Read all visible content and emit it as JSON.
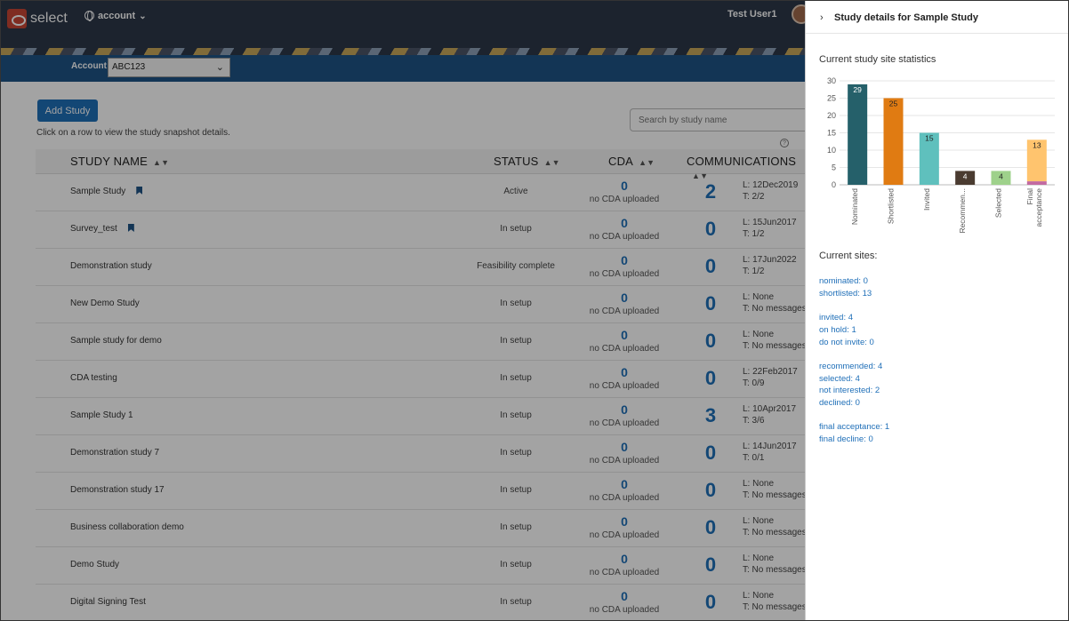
{
  "header": {
    "app_name": "select",
    "account_menu": "account",
    "user_name": "Test User1"
  },
  "account_bar": {
    "label": "Account:",
    "selected": "ABC123"
  },
  "toolbar": {
    "add_study": "Add Study",
    "hint": "Click on a row to view the study snapshot details.",
    "search_placeholder": "Search by study name"
  },
  "table": {
    "columns": [
      "STUDY NAME",
      "STATUS",
      "CDA",
      "COMMUNICATIONS"
    ],
    "rows": [
      {
        "name": "Sample Study",
        "bookmarked": true,
        "status": "Active",
        "cda": "0",
        "cda_text": "no CDA uploaded",
        "comm": "2",
        "last": "L: 12Dec2019",
        "threads": "T: 2/2"
      },
      {
        "name": "Survey_test",
        "bookmarked": true,
        "status": "In setup",
        "cda": "0",
        "cda_text": "no CDA uploaded",
        "comm": "0",
        "last": "L: 15Jun2017",
        "threads": "T: 1/2"
      },
      {
        "name": "Demonstration study",
        "bookmarked": false,
        "status": "Feasibility complete",
        "cda": "0",
        "cda_text": "no CDA uploaded",
        "comm": "0",
        "last": "L: 17Jun2022",
        "threads": "T: 1/2"
      },
      {
        "name": "New Demo Study",
        "bookmarked": false,
        "status": "In setup",
        "cda": "0",
        "cda_text": "no CDA uploaded",
        "comm": "0",
        "last": "L: None",
        "threads": "T: No messages"
      },
      {
        "name": "Sample study for demo",
        "bookmarked": false,
        "status": "In setup",
        "cda": "0",
        "cda_text": "no CDA uploaded",
        "comm": "0",
        "last": "L: None",
        "threads": "T: No messages"
      },
      {
        "name": "CDA testing",
        "bookmarked": false,
        "status": "In setup",
        "cda": "0",
        "cda_text": "no CDA uploaded",
        "comm": "0",
        "last": "L: 22Feb2017",
        "threads": "T: 0/9"
      },
      {
        "name": "Sample Study 1",
        "bookmarked": false,
        "status": "In setup",
        "cda": "0",
        "cda_text": "no CDA uploaded",
        "comm": "3",
        "last": "L: 10Apr2017",
        "threads": "T: 3/6"
      },
      {
        "name": "Demonstration study 7",
        "bookmarked": false,
        "status": "In setup",
        "cda": "0",
        "cda_text": "no CDA uploaded",
        "comm": "0",
        "last": "L: 14Jun2017",
        "threads": "T: 0/1"
      },
      {
        "name": "Demonstration study 17",
        "bookmarked": false,
        "status": "In setup",
        "cda": "0",
        "cda_text": "no CDA uploaded",
        "comm": "0",
        "last": "L: None",
        "threads": "T: No messages"
      },
      {
        "name": "Business collaboration demo",
        "bookmarked": false,
        "status": "In setup",
        "cda": "0",
        "cda_text": "no CDA uploaded",
        "comm": "0",
        "last": "L: None",
        "threads": "T: No messages"
      },
      {
        "name": "Demo Study",
        "bookmarked": false,
        "status": "In setup",
        "cda": "0",
        "cda_text": "no CDA uploaded",
        "comm": "0",
        "last": "L: None",
        "threads": "T: No messages"
      },
      {
        "name": "Digital Signing Test",
        "bookmarked": false,
        "status": "In setup",
        "cda": "0",
        "cda_text": "no CDA uploaded",
        "comm": "0",
        "last": "L: None",
        "threads": "T: No messages"
      }
    ]
  },
  "panel": {
    "title": "Study details for Sample Study",
    "stats_title": "Current study site statistics",
    "sites_title": "Current sites:",
    "site_groups": [
      [
        "nominated: 0",
        "shortlisted: 13"
      ],
      [
        "invited: 4",
        "on hold: 1",
        "do not invite: 0"
      ],
      [
        "recommended: 4",
        "selected: 4",
        "not interested: 2",
        "declined: 0"
      ],
      [
        "final acceptance: 1",
        "final decline: 0"
      ]
    ]
  },
  "chart_data": {
    "type": "bar",
    "categories": [
      "Nominated",
      "Shortlisted",
      "Invited",
      "Recommen...",
      "Selected",
      "Final acceptance"
    ],
    "values": [
      29,
      25,
      15,
      4,
      4,
      13
    ],
    "stacked_extra": [
      0,
      0,
      0,
      0,
      0,
      1
    ],
    "data_labels": [
      "29",
      "25",
      "15",
      "4",
      "4",
      "13"
    ],
    "colors": [
      "#25606a",
      "#e07b12",
      "#5fc0bd",
      "#4a3b30",
      "#9ed18b",
      "#ffc46e"
    ],
    "extra_color": "#c36aa0",
    "ylim": [
      0,
      30
    ],
    "yticks": [
      0,
      5,
      10,
      15,
      20,
      25,
      30
    ],
    "grid": true
  }
}
